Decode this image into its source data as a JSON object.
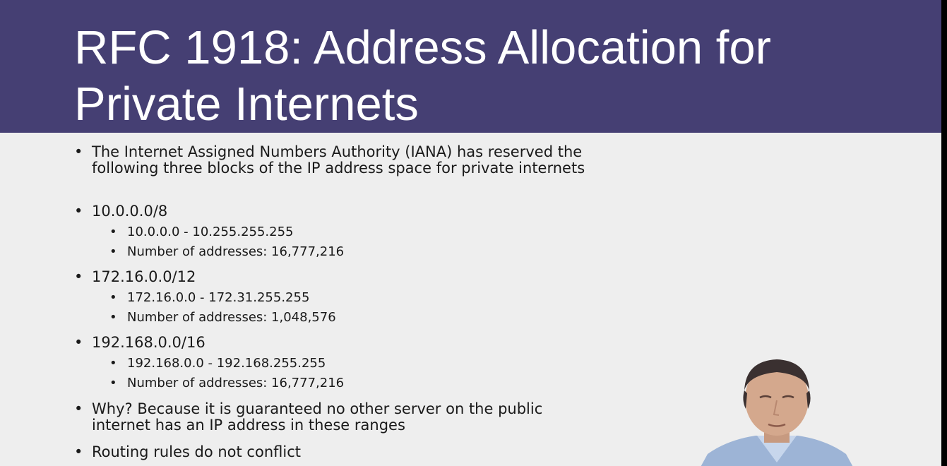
{
  "slide": {
    "title_line1": "RFC 1918: Address Allocation for",
    "title_line2": "Private Internets",
    "bullet_glyph": "•",
    "bullets": [
      {
        "text": "The Internet Assigned Numbers Authority (IANA) has reserved the following three blocks of the IP address space for private internets"
      },
      {
        "text": "10.0.0.0/8",
        "sub": [
          "10.0.0.0 - 10.255.255.255",
          "Number of addresses: 16,777,216"
        ]
      },
      {
        "text": "172.16.0.0/12",
        "sub": [
          "172.16.0.0 - 172.31.255.255",
          "Number of addresses: 1,048,576"
        ]
      },
      {
        "text": "192.168.0.0/16",
        "sub": [
          "192.168.0.0 - 192.168.255.255",
          "Number of addresses: 16,777,216"
        ]
      },
      {
        "text": "Why? Because it is guaranteed no other server on the public internet has an IP address in these ranges"
      },
      {
        "text": "Routing rules do not conflict"
      }
    ]
  },
  "colors": {
    "title_bar": "#453f73",
    "title_text": "#ffffff",
    "slide_background": "#eeeeee",
    "body_text": "#1a1a1a"
  }
}
